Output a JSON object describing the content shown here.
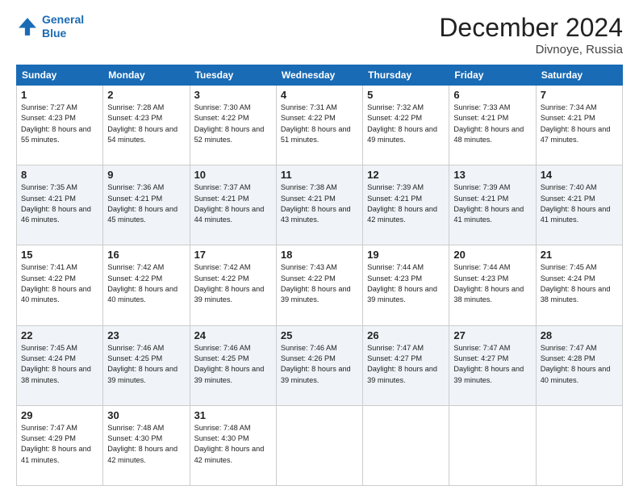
{
  "header": {
    "logo_line1": "General",
    "logo_line2": "Blue",
    "month_title": "December 2024",
    "location": "Divnoye, Russia"
  },
  "weekdays": [
    "Sunday",
    "Monday",
    "Tuesday",
    "Wednesday",
    "Thursday",
    "Friday",
    "Saturday"
  ],
  "weeks": [
    [
      {
        "day": "1",
        "rise": "7:27 AM",
        "set": "4:23 PM",
        "daylight": "8 hours and 55 minutes."
      },
      {
        "day": "2",
        "rise": "7:28 AM",
        "set": "4:23 PM",
        "daylight": "8 hours and 54 minutes."
      },
      {
        "day": "3",
        "rise": "7:30 AM",
        "set": "4:22 PM",
        "daylight": "8 hours and 52 minutes."
      },
      {
        "day": "4",
        "rise": "7:31 AM",
        "set": "4:22 PM",
        "daylight": "8 hours and 51 minutes."
      },
      {
        "day": "5",
        "rise": "7:32 AM",
        "set": "4:22 PM",
        "daylight": "8 hours and 49 minutes."
      },
      {
        "day": "6",
        "rise": "7:33 AM",
        "set": "4:21 PM",
        "daylight": "8 hours and 48 minutes."
      },
      {
        "day": "7",
        "rise": "7:34 AM",
        "set": "4:21 PM",
        "daylight": "8 hours and 47 minutes."
      }
    ],
    [
      {
        "day": "8",
        "rise": "7:35 AM",
        "set": "4:21 PM",
        "daylight": "8 hours and 46 minutes."
      },
      {
        "day": "9",
        "rise": "7:36 AM",
        "set": "4:21 PM",
        "daylight": "8 hours and 45 minutes."
      },
      {
        "day": "10",
        "rise": "7:37 AM",
        "set": "4:21 PM",
        "daylight": "8 hours and 44 minutes."
      },
      {
        "day": "11",
        "rise": "7:38 AM",
        "set": "4:21 PM",
        "daylight": "8 hours and 43 minutes."
      },
      {
        "day": "12",
        "rise": "7:39 AM",
        "set": "4:21 PM",
        "daylight": "8 hours and 42 minutes."
      },
      {
        "day": "13",
        "rise": "7:39 AM",
        "set": "4:21 PM",
        "daylight": "8 hours and 41 minutes."
      },
      {
        "day": "14",
        "rise": "7:40 AM",
        "set": "4:21 PM",
        "daylight": "8 hours and 41 minutes."
      }
    ],
    [
      {
        "day": "15",
        "rise": "7:41 AM",
        "set": "4:22 PM",
        "daylight": "8 hours and 40 minutes."
      },
      {
        "day": "16",
        "rise": "7:42 AM",
        "set": "4:22 PM",
        "daylight": "8 hours and 40 minutes."
      },
      {
        "day": "17",
        "rise": "7:42 AM",
        "set": "4:22 PM",
        "daylight": "8 hours and 39 minutes."
      },
      {
        "day": "18",
        "rise": "7:43 AM",
        "set": "4:22 PM",
        "daylight": "8 hours and 39 minutes."
      },
      {
        "day": "19",
        "rise": "7:44 AM",
        "set": "4:23 PM",
        "daylight": "8 hours and 39 minutes."
      },
      {
        "day": "20",
        "rise": "7:44 AM",
        "set": "4:23 PM",
        "daylight": "8 hours and 38 minutes."
      },
      {
        "day": "21",
        "rise": "7:45 AM",
        "set": "4:24 PM",
        "daylight": "8 hours and 38 minutes."
      }
    ],
    [
      {
        "day": "22",
        "rise": "7:45 AM",
        "set": "4:24 PM",
        "daylight": "8 hours and 38 minutes."
      },
      {
        "day": "23",
        "rise": "7:46 AM",
        "set": "4:25 PM",
        "daylight": "8 hours and 39 minutes."
      },
      {
        "day": "24",
        "rise": "7:46 AM",
        "set": "4:25 PM",
        "daylight": "8 hours and 39 minutes."
      },
      {
        "day": "25",
        "rise": "7:46 AM",
        "set": "4:26 PM",
        "daylight": "8 hours and 39 minutes."
      },
      {
        "day": "26",
        "rise": "7:47 AM",
        "set": "4:27 PM",
        "daylight": "8 hours and 39 minutes."
      },
      {
        "day": "27",
        "rise": "7:47 AM",
        "set": "4:27 PM",
        "daylight": "8 hours and 39 minutes."
      },
      {
        "day": "28",
        "rise": "7:47 AM",
        "set": "4:28 PM",
        "daylight": "8 hours and 40 minutes."
      }
    ],
    [
      {
        "day": "29",
        "rise": "7:47 AM",
        "set": "4:29 PM",
        "daylight": "8 hours and 41 minutes."
      },
      {
        "day": "30",
        "rise": "7:48 AM",
        "set": "4:30 PM",
        "daylight": "8 hours and 42 minutes."
      },
      {
        "day": "31",
        "rise": "7:48 AM",
        "set": "4:30 PM",
        "daylight": "8 hours and 42 minutes."
      },
      null,
      null,
      null,
      null
    ]
  ]
}
